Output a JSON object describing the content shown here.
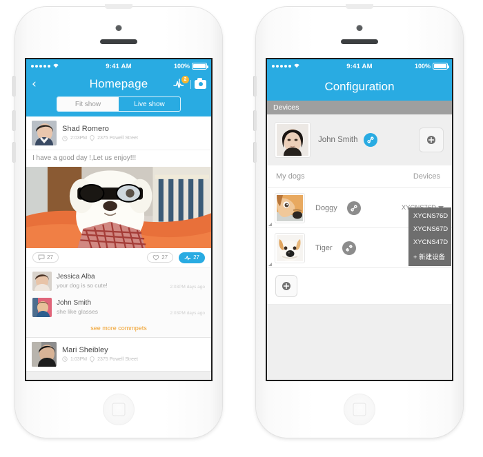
{
  "phone_left": {
    "status_bar": {
      "signal_dots": 5,
      "wifi": "wifi-icon",
      "time": "9:41 AM",
      "battery_pct": "100%"
    },
    "nav": {
      "back": "‹",
      "title": "Homepage",
      "pulse_icon": "pulse-icon",
      "badge": "2",
      "camera_icon": "camera-icon"
    },
    "segments": [
      {
        "label": "Fit show",
        "active": true
      },
      {
        "label": "Live show",
        "active": false
      }
    ],
    "posts": [
      {
        "author": "Shad Romero",
        "time": "2:03PM",
        "location": "2375 Powell Street",
        "text": "I have a good day !,Let us enjoy!!!",
        "image": "dog-with-glasses",
        "comment_count": "27",
        "like_count": "27",
        "share_count": "27",
        "comments": [
          {
            "name": "Jessica Alba",
            "text": "your dog is so cute!",
            "time": "2:03PM days ago"
          },
          {
            "name": "John Smith",
            "text": "she like glasses",
            "time": "2:03PM days ago"
          }
        ],
        "more_label": "see more commpets"
      },
      {
        "author": "Mari Sheibley",
        "time": "1:03PM",
        "location": "2375 Powell Street"
      }
    ]
  },
  "phone_right": {
    "status_bar": {
      "signal_dots": 5,
      "wifi": "wifi-icon",
      "time": "9:41 AM",
      "battery_pct": "100%"
    },
    "nav": {
      "title": "Configuration"
    },
    "section_header": "Devices",
    "user": {
      "name": "John Smith",
      "link_icon": "link-icon",
      "add_button": "plus-icon"
    },
    "tabs": {
      "left": "My dogs",
      "right": "Devices"
    },
    "devices": [
      {
        "name": "Doggy",
        "link_state": "linked",
        "selected_device": "XYCNS76D"
      },
      {
        "name": "Tiger",
        "link_state": "unlinked",
        "selected_device": ""
      }
    ],
    "dropdown": {
      "open": true,
      "options": [
        "XYCNS76D",
        "XYCNS67D",
        "XYCNS47D",
        "+ 新建设备"
      ]
    },
    "add_device_button": "plus-icon"
  },
  "colors": {
    "accent_blue": "#29ABE2",
    "badge_orange": "#F7B733",
    "link_orange": "#F0A12E",
    "section_gray": "#9f9f9f",
    "dropdown_gray": "#6e6e6e"
  }
}
